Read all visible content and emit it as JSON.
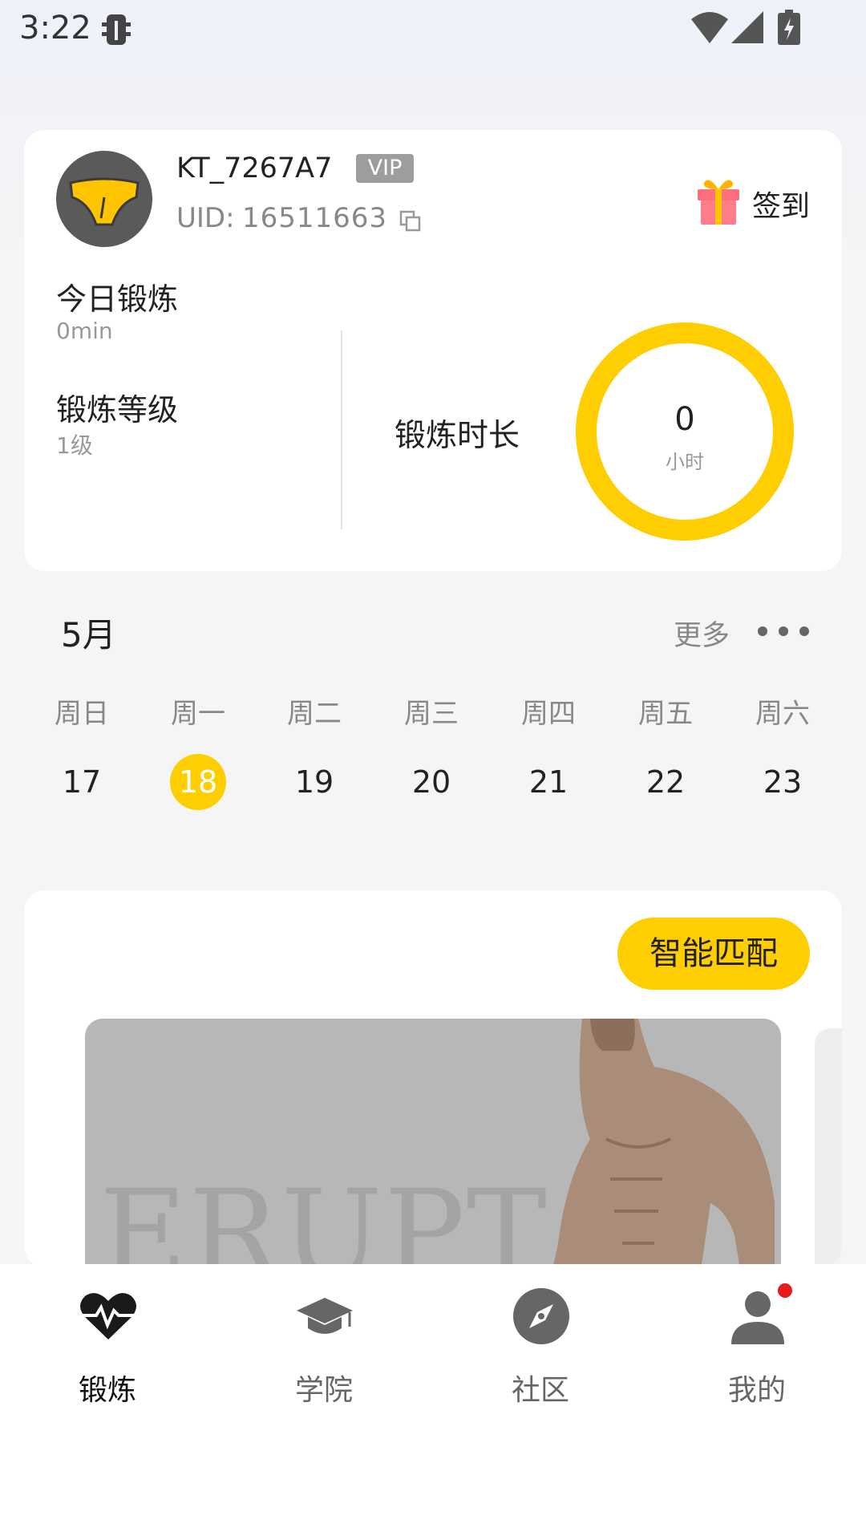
{
  "status_bar": {
    "time": "3:22"
  },
  "profile": {
    "username": "KT_7267A7",
    "vip_badge": "VIP",
    "uid_label": "UID:",
    "uid_value": "16511663",
    "checkin_label": "签到"
  },
  "stats": {
    "today_title": "今日锻炼",
    "today_value": "0min",
    "level_title": "锻炼等级",
    "level_value": "1级",
    "duration_label": "锻炼时长",
    "duration_value": "0",
    "duration_unit": "小时"
  },
  "calendar": {
    "month": "5月",
    "more_label": "更多",
    "weekdays": [
      "周日",
      "周一",
      "周二",
      "周三",
      "周四",
      "周五",
      "周六"
    ],
    "days": [
      "17",
      "18",
      "19",
      "20",
      "21",
      "22",
      "23"
    ],
    "selected_day": "18"
  },
  "workout": {
    "smart_match_label": "智能匹配",
    "banner_text": "ERUPT"
  },
  "bottom_nav": {
    "items": [
      {
        "label": "锻炼",
        "icon": "heartbeat-icon",
        "active": true
      },
      {
        "label": "学院",
        "icon": "graduation-cap-icon",
        "active": false
      },
      {
        "label": "社区",
        "icon": "compass-icon",
        "active": false
      },
      {
        "label": "我的",
        "icon": "user-icon",
        "active": false,
        "has_badge": true
      }
    ]
  },
  "colors": {
    "accent": "#ffce00",
    "badge": "#e51c1c"
  }
}
